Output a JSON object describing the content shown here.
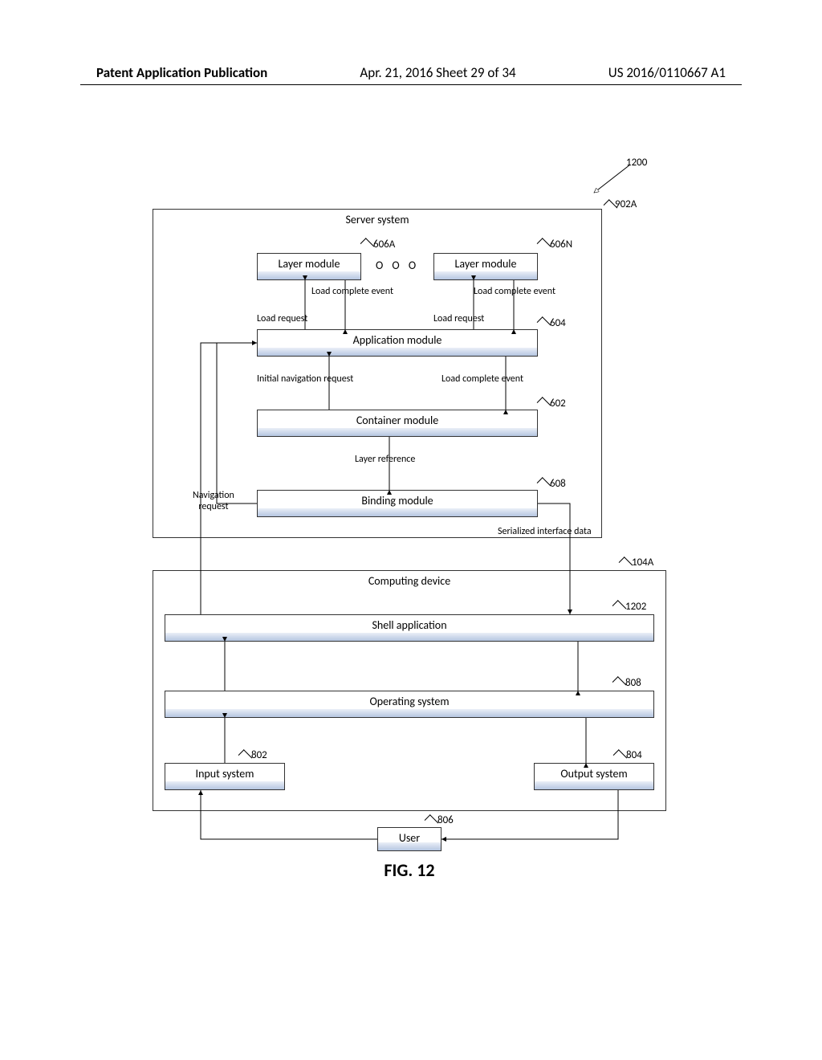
{
  "header": {
    "left": "Patent Application Publication",
    "mid": "Apr. 21, 2016  Sheet 29 of 34",
    "right": "US 2016/0110667 A1"
  },
  "refs": {
    "r1200": "1200",
    "r902A": "902A",
    "r606A": "606A",
    "r606N": "606N",
    "r604": "604",
    "r602": "602",
    "r608": "608",
    "r104A": "104A",
    "r1202": "1202",
    "r808": "808",
    "r802": "802",
    "r804": "804",
    "r806": "806"
  },
  "boxes": {
    "server_system": "Server system",
    "layer_module_a": "Layer module",
    "layer_module_n": "Layer module",
    "application_module": "Application module",
    "container_module": "Container module",
    "binding_module": "Binding module",
    "computing_device": "Computing device",
    "shell_application": "Shell application",
    "operating_system": "Operating system",
    "input_system": "Input system",
    "output_system": "Output system",
    "user": "User"
  },
  "labels": {
    "load_complete_1": "Load complete event",
    "load_complete_2": "Load complete event",
    "load_request_1": "Load request",
    "load_request_2": "Load request",
    "initial_nav": "Initial navigation request",
    "load_complete_3": "Load complete event",
    "layer_reference": "Layer reference",
    "navigation_request": "Navigation\nrequest",
    "serialized": "Serialized interface data"
  },
  "dots": "O O O",
  "figure": "FIG. 12"
}
